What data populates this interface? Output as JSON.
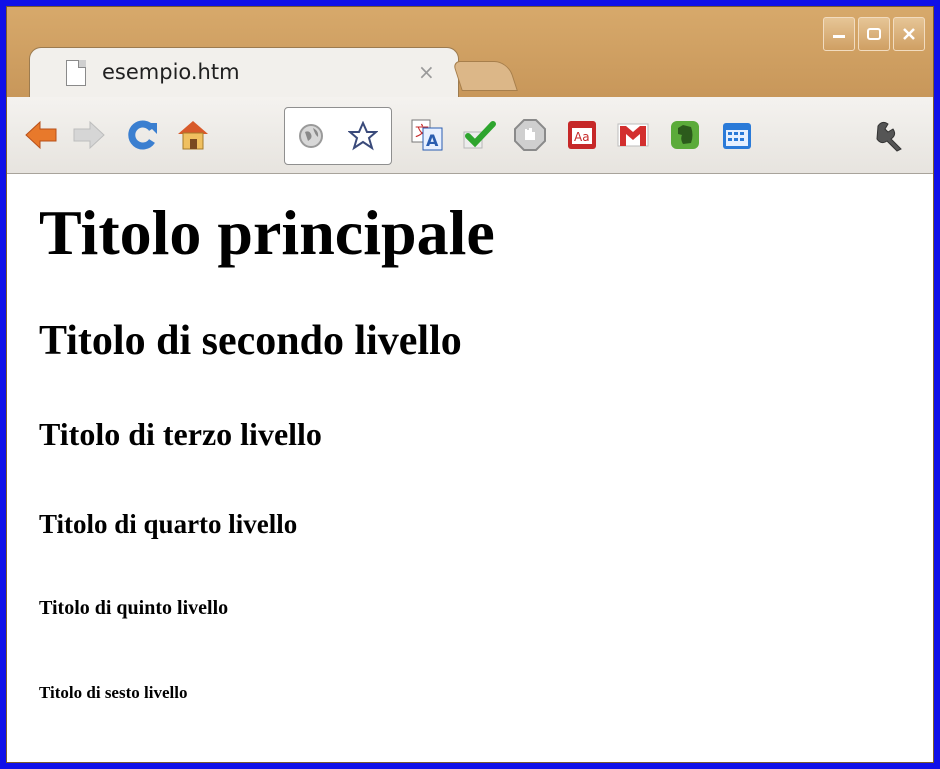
{
  "window": {
    "tab_title": "esempio.htm",
    "tab_close": "×",
    "buttons": {
      "minimize": "minimize-icon",
      "maximize": "maximize-icon",
      "close": "close-icon"
    }
  },
  "toolbar": {
    "icons": [
      "back-arrow-icon",
      "forward-arrow-icon",
      "reload-icon",
      "home-icon",
      "globe-icon",
      "star-icon",
      "translate-icon",
      "checkmark-icon",
      "stop-sign-icon",
      "dictionary-icon",
      "gmail-icon",
      "evernote-icon",
      "calendar-icon",
      "wrench-icon"
    ],
    "colors": {
      "back": "#e8792b",
      "forward": "#c9c9c9",
      "reload": "#3b7fd0",
      "home": "#d85a2a",
      "check": "#2ea52e",
      "dict": "#c62828",
      "gmail": "#d32f2f",
      "evernote": "#5bab3a",
      "calendar": "#2a7ad8"
    }
  },
  "page": {
    "h1": "Titolo principale",
    "h2": "Titolo di secondo livello",
    "h3": "Titolo di terzo livello",
    "h4": "Titolo di quarto livello",
    "h5": "Titolo di quinto livello",
    "h6": "Titolo di sesto livello"
  }
}
